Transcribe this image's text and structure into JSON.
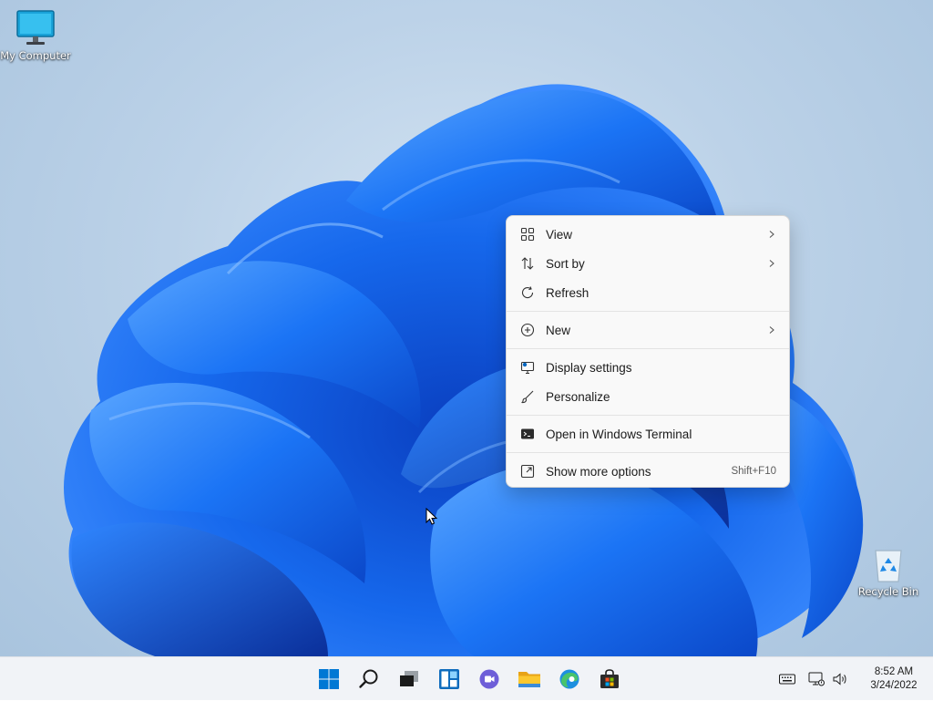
{
  "desktop": {
    "icons": [
      {
        "label": "My Computer",
        "icon": "monitor-icon"
      },
      {
        "label": "Recycle Bin",
        "icon": "recycle-bin-icon"
      }
    ]
  },
  "context_menu": {
    "items": [
      {
        "label": "View",
        "icon": "grid-view-icon",
        "submenu": true
      },
      {
        "label": "Sort by",
        "icon": "sort-arrows-icon",
        "submenu": true
      },
      {
        "label": "Refresh",
        "icon": "refresh-icon"
      },
      {
        "label": "New",
        "icon": "plus-circle-icon",
        "submenu": true
      },
      {
        "label": "Display settings",
        "icon": "display-settings-icon"
      },
      {
        "label": "Personalize",
        "icon": "brush-icon"
      },
      {
        "label": "Open in Windows Terminal",
        "icon": "terminal-icon"
      },
      {
        "label": "Show more options",
        "icon": "expand-icon",
        "shortcut": "Shift+F10"
      }
    ]
  },
  "taskbar": {
    "apps": [
      {
        "name": "start",
        "icon": "windows-start-icon"
      },
      {
        "name": "search",
        "icon": "search-icon"
      },
      {
        "name": "task-view",
        "icon": "task-view-icon"
      },
      {
        "name": "widgets",
        "icon": "widgets-icon"
      },
      {
        "name": "chat",
        "icon": "chat-icon"
      },
      {
        "name": "file-explorer",
        "icon": "folder-icon"
      },
      {
        "name": "edge",
        "icon": "edge-browser-icon"
      },
      {
        "name": "store",
        "icon": "store-bag-icon"
      }
    ],
    "tray": {
      "icons": [
        "keyboard-icon",
        "network-icon",
        "volume-icon"
      ],
      "time": "8:52 AM",
      "date": "3/24/2022"
    }
  },
  "colors": {
    "accent": "#0067c0",
    "bloom": "#1a6cf0",
    "taskbar_bg": "#f1f3f7",
    "menu_bg": "#f9f9f9"
  }
}
